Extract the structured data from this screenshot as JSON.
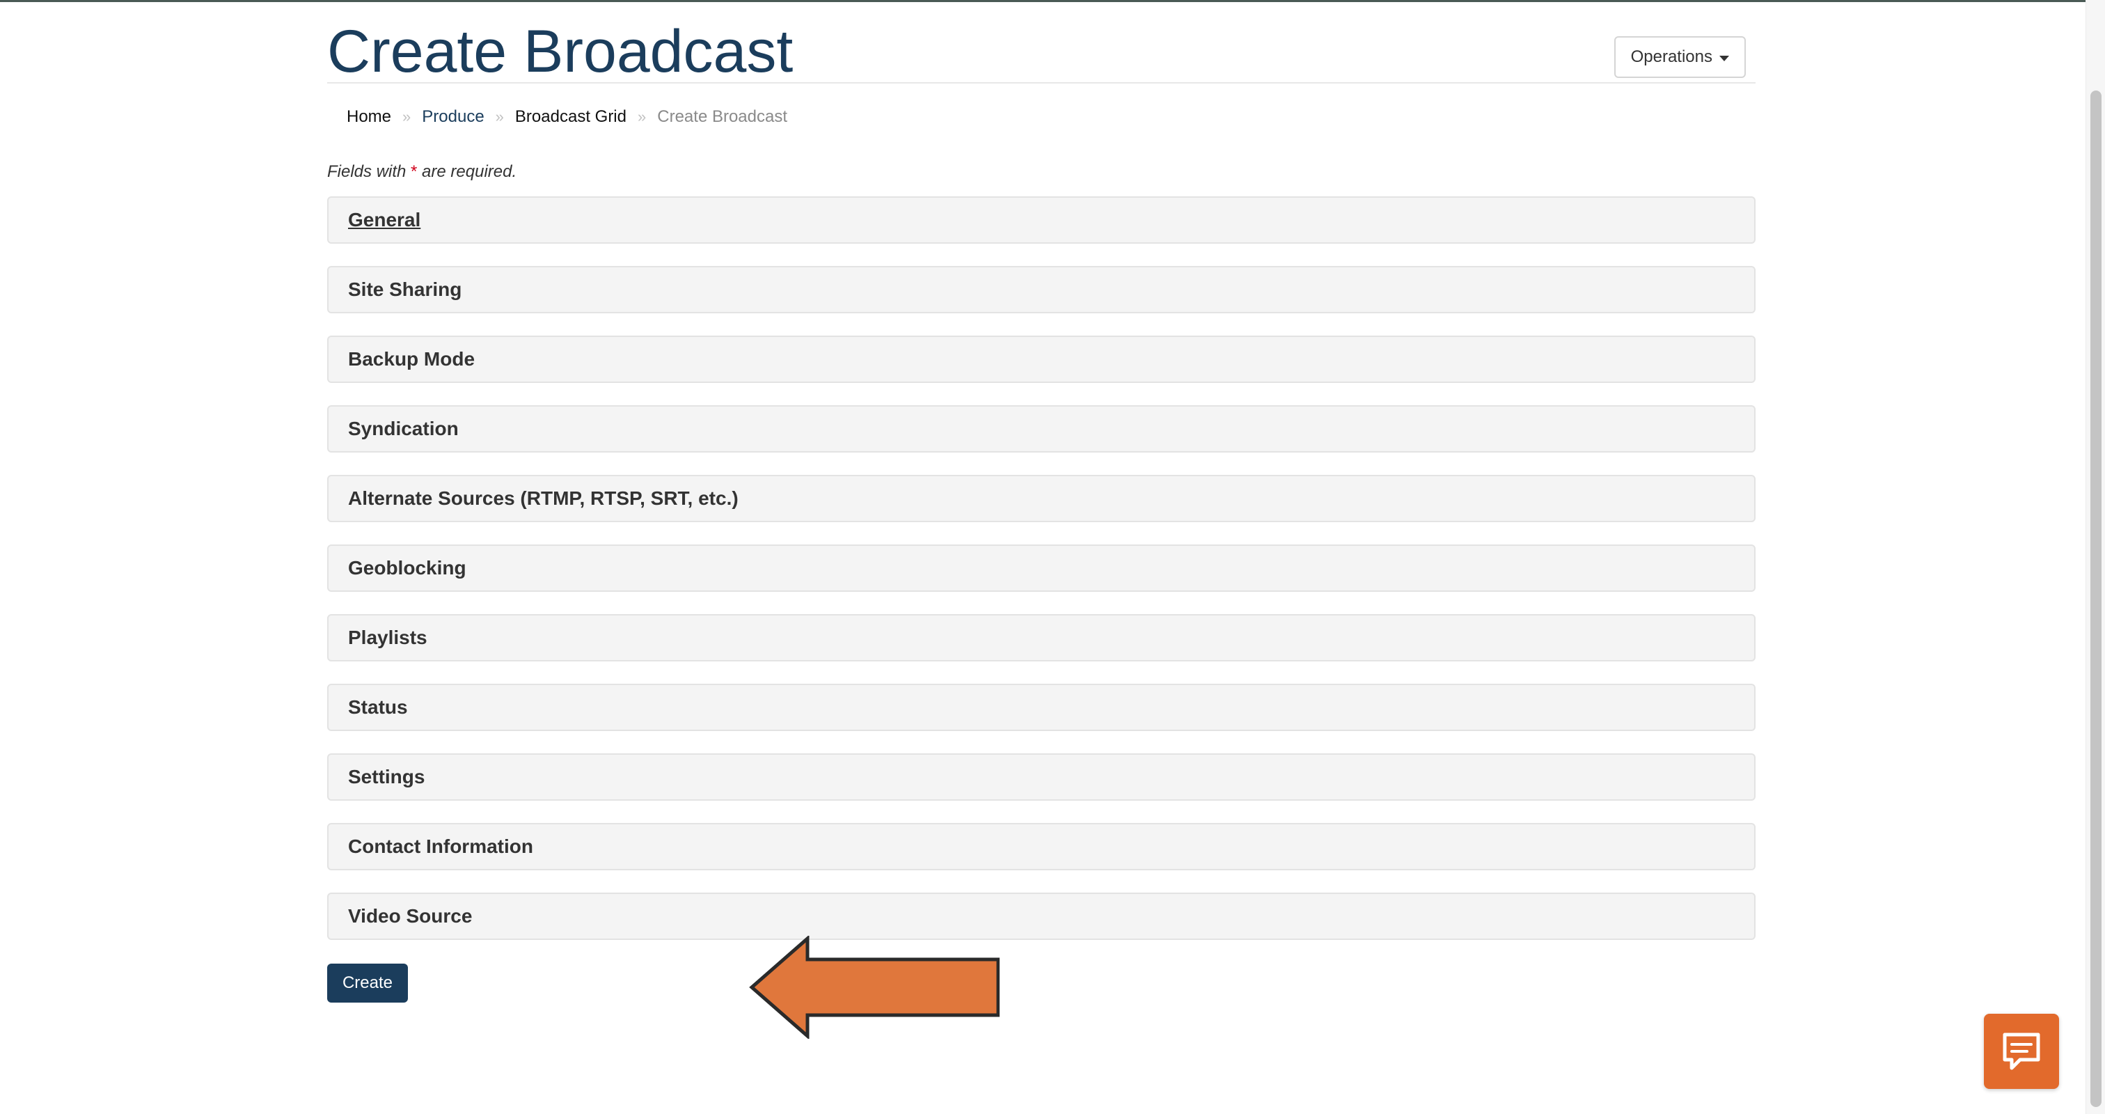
{
  "header": {
    "title": "Create Broadcast",
    "operations_label": "Operations"
  },
  "breadcrumb": {
    "home": "Home",
    "produce": "Produce",
    "grid": "Broadcast Grid",
    "current": "Create Broadcast",
    "separator": "»"
  },
  "form": {
    "required_prefix": "Fields with ",
    "required_star": "*",
    "required_suffix": " are required.",
    "sections": [
      "General",
      "Site Sharing",
      "Backup Mode",
      "Syndication",
      "Alternate Sources (RTMP, RTSP, SRT, etc.)",
      "Geoblocking",
      "Playlists",
      "Status",
      "Settings",
      "Contact Information",
      "Video Source"
    ],
    "create_label": "Create"
  },
  "icons": {
    "chat": "chat-bubble-icon",
    "annotation": "arrow-left-icon"
  },
  "colors": {
    "primary": "#1b3d5c",
    "accent": "#e26a2c",
    "required": "#d0021b"
  }
}
